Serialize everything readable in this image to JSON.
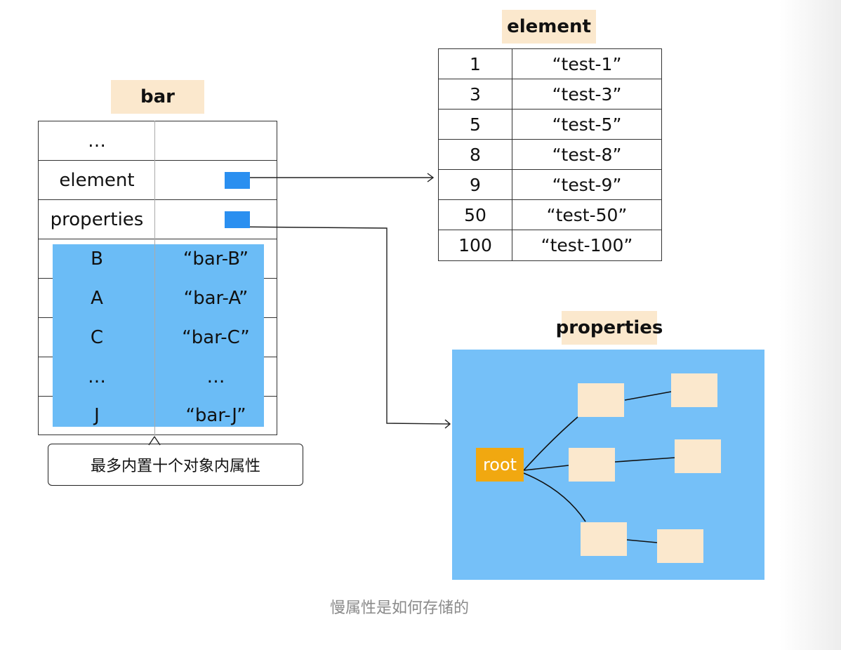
{
  "bar": {
    "title": "bar",
    "rows": [
      {
        "key": "…",
        "value": ""
      },
      {
        "key": "element",
        "value": ""
      },
      {
        "key": "properties",
        "value": ""
      },
      {
        "key": "B",
        "value": "“bar-B”"
      },
      {
        "key": "A",
        "value": "“bar-A”"
      },
      {
        "key": "C",
        "value": "“bar-C”"
      },
      {
        "key": "…",
        "value": "…"
      },
      {
        "key": "J",
        "value": "“bar-J”"
      }
    ],
    "note": "最多内置十个对象内属性"
  },
  "element": {
    "title": "element",
    "rows": [
      {
        "key": "1",
        "value": "“test-1”"
      },
      {
        "key": "3",
        "value": "“test-3”"
      },
      {
        "key": "5",
        "value": "“test-5”"
      },
      {
        "key": "8",
        "value": "“test-8”"
      },
      {
        "key": "9",
        "value": "“test-9”"
      },
      {
        "key": "50",
        "value": "“test-50”"
      },
      {
        "key": "100",
        "value": "“test-100”"
      }
    ]
  },
  "properties": {
    "title": "properties",
    "root_label": "root"
  },
  "caption": "慢属性是如何存储的",
  "colors": {
    "label_bg": "#fbe8cd",
    "in_object_bg": "#6bbcf6",
    "pointer": "#2a8ff0",
    "panel_bg": "#75c0f8",
    "root": "#f1a810"
  }
}
